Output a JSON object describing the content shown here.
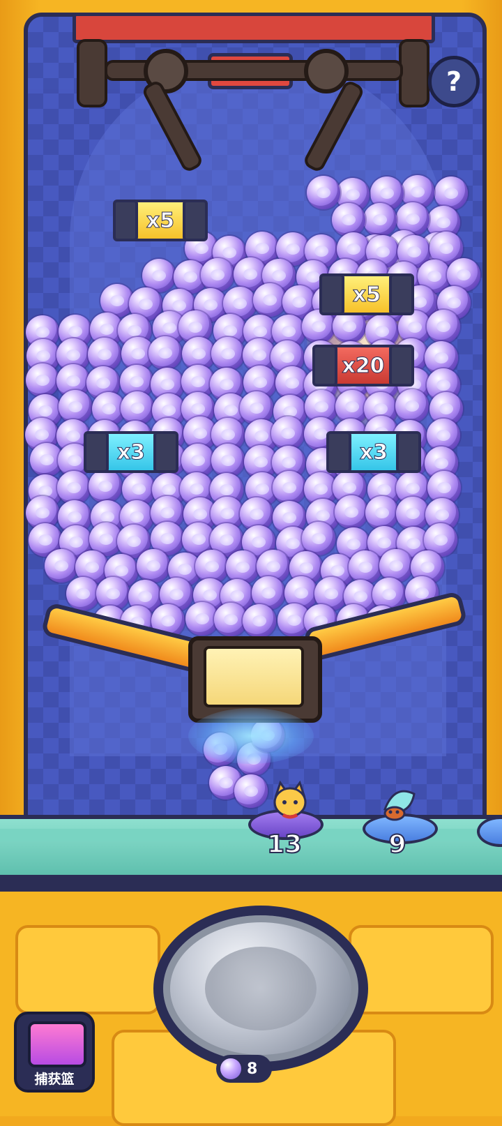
{
  "game": {
    "help_label": "?",
    "multipliers": [
      {
        "label": "x5",
        "style": "gold"
      },
      {
        "label": "x5",
        "style": "gold"
      },
      {
        "label": "x20",
        "style": "red"
      },
      {
        "label": "x3",
        "style": "cyan"
      },
      {
        "label": "x3",
        "style": "cyan"
      }
    ],
    "pets": [
      {
        "name": "cat",
        "count": "13"
      },
      {
        "name": "hermit-crab",
        "count": "9"
      }
    ],
    "basket_label": "捕获篮",
    "ball_count": "8"
  },
  "colors": {
    "frame": "#f6b523",
    "machine_bg": "#4a5bc2",
    "outline": "#2b2d55",
    "ball": "#b08cf2",
    "shelf": "#8ee0cf"
  },
  "icons": [
    "help-icon",
    "claw-icon",
    "paw-ball-icon",
    "basket-icon",
    "drop-button-icon"
  ]
}
